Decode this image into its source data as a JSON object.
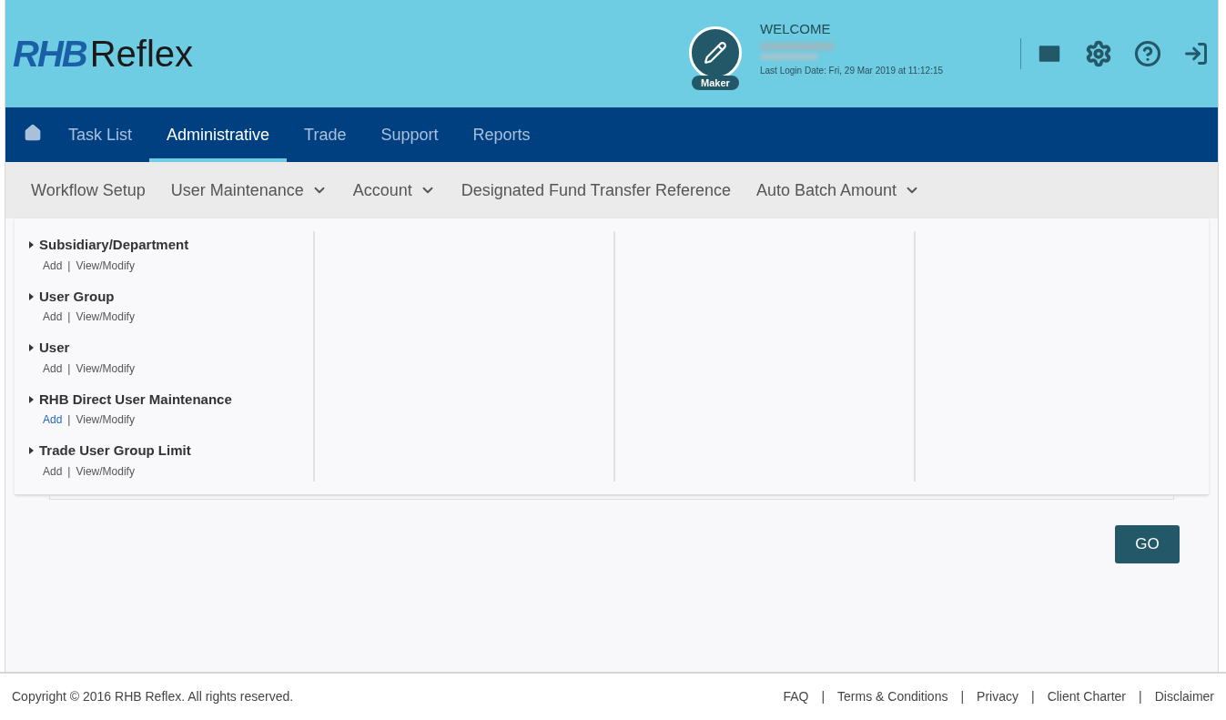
{
  "header": {
    "logo_mark": "RHB",
    "logo_text": "Reflex",
    "role_badge": "Maker",
    "welcome": "WELCOME",
    "last_login": "Last Login Date: Fri, 29 Mar 2019 at 11:12:15"
  },
  "nav": [
    {
      "kind": "home",
      "selected": false
    },
    {
      "kind": "text",
      "label": "Task List",
      "selected": false
    },
    {
      "kind": "text",
      "label": "Administrative",
      "selected": true
    },
    {
      "kind": "text",
      "label": "Trade",
      "selected": false
    },
    {
      "kind": "text",
      "label": "Support",
      "selected": false
    },
    {
      "kind": "text",
      "label": "Reports",
      "selected": false
    }
  ],
  "submenu": [
    {
      "label": "Workflow Setup",
      "dropdown": false
    },
    {
      "label": "User Maintenance",
      "dropdown": true
    },
    {
      "label": "Account",
      "dropdown": true
    },
    {
      "label": "Designated Fund Transfer Reference",
      "dropdown": false
    },
    {
      "label": "Auto Batch Amount",
      "dropdown": true
    }
  ],
  "menu_items": [
    {
      "title": "Subsidiary/Department",
      "add": "Add",
      "separator": "|",
      "view": "View/Modify",
      "add_highlighted": false
    },
    {
      "title": "User Group",
      "add": "Add",
      "separator": "|",
      "view": "View/Modify",
      "add_highlighted": false
    },
    {
      "title": "User",
      "add": "Add",
      "separator": "|",
      "view": "View/Modify",
      "add_highlighted": false
    },
    {
      "title": "RHB Direct User Maintenance",
      "add": "Add",
      "separator": "|",
      "view": "View/Modify",
      "add_highlighted": true
    },
    {
      "title": "Trade User Group Limit",
      "add": "Add",
      "separator": "|",
      "view": "View/Modify",
      "add_highlighted": false
    }
  ],
  "go_button": "GO",
  "footer": {
    "copyright": "Copyright © 2016 RHB Reflex. All rights reserved.",
    "separator": "|",
    "links": [
      "FAQ",
      "Terms & Conditions",
      "Privacy",
      "Client Charter",
      "Disclaimer"
    ]
  }
}
